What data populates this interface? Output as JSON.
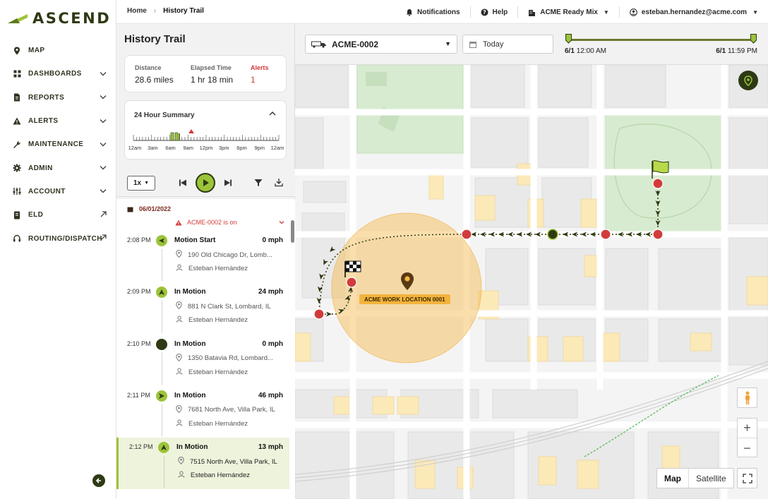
{
  "brand": {
    "name": "ASCEND",
    "accent": "#9cc43a",
    "dark": "#2e3a14"
  },
  "sidebar": {
    "items": [
      {
        "label": "MAP",
        "icon": "map-pin-icon",
        "right": ""
      },
      {
        "label": "DASHBOARDS",
        "icon": "grid-icon",
        "right": "chevron"
      },
      {
        "label": "REPORTS",
        "icon": "document-icon",
        "right": "chevron"
      },
      {
        "label": "ALERTS",
        "icon": "warning-icon",
        "right": "chevron"
      },
      {
        "label": "MAINTENANCE",
        "icon": "wrench-icon",
        "right": "chevron"
      },
      {
        "label": "ADMIN",
        "icon": "gear-icon",
        "right": "chevron"
      },
      {
        "label": "ACCOUNT",
        "icon": "sliders-icon",
        "right": "chevron"
      },
      {
        "label": "ELD",
        "icon": "logbook-icon",
        "right": "external"
      },
      {
        "label": "ROUTING/DISPATCH",
        "icon": "headset-icon",
        "right": "external"
      }
    ]
  },
  "topbar": {
    "breadcrumb_home": "Home",
    "breadcrumb_current": "History Trail",
    "notifications": "Notifications",
    "help": "Help",
    "company": "ACME Ready Mix",
    "user_email": "esteban.hernandez@acme.com"
  },
  "panel": {
    "title": "History Trail",
    "stats": {
      "distance_label": "Distance",
      "distance_value": "28.6 miles",
      "elapsed_label": "Elapsed Time",
      "elapsed_value": "1 hr 18 min",
      "alerts_label": "Alerts",
      "alerts_value": "1"
    },
    "summary": {
      "title": "24 Hour Summary",
      "ticks": [
        "12am",
        "3am",
        "6am",
        "9am",
        "12pm",
        "3pm",
        "6pm",
        "9pm",
        "12am"
      ]
    },
    "speed": "1x",
    "date": "06/01/2022",
    "alert_text": "ACME-0002 is on",
    "events": [
      {
        "time": "2:08 PM",
        "title": "Motion Start",
        "speed": "0 mph",
        "address": "190 Old Chicago Dr, Lomb...",
        "driver": "Esteban Hernández",
        "icon": "motion-start-icon",
        "selected": false
      },
      {
        "time": "2:09 PM",
        "title": "In Motion",
        "speed": "24 mph",
        "address": "881 N Clark St, Lombard, IL",
        "driver": "Esteban Hernández",
        "icon": "heading-north-icon",
        "selected": false
      },
      {
        "time": "2:10 PM",
        "title": "In Motion",
        "speed": "0 mph",
        "address": "1350 Batavia Rd, Lombard...",
        "driver": "Esteban Hernández",
        "icon": "stopped-dot-icon",
        "selected": false
      },
      {
        "time": "2:11 PM",
        "title": "In Motion",
        "speed": "46 mph",
        "address": "7681 North Ave, Villa Park, IL",
        "driver": "Esteban Hernández",
        "icon": "heading-east-icon",
        "selected": false
      },
      {
        "time": "2:12 PM",
        "title": "In Motion",
        "speed": "13 mph",
        "address": "7515 North Ave, Villa Park, IL",
        "driver": "Esteban Hernández",
        "icon": "heading-north-icon",
        "selected": true
      }
    ]
  },
  "map_toolbar": {
    "vehicle": "ACME-0002",
    "date": "Today",
    "range_start_date": "6/1",
    "range_start_time": "12:00 AM",
    "range_end_date": "6/1",
    "range_end_time": "11:59 PM"
  },
  "map": {
    "work_location": "ACME WORK LOCATION 0001",
    "map_type_map": "Map",
    "map_type_satellite": "Satellite",
    "zoom_in": "+",
    "zoom_out": "−"
  }
}
